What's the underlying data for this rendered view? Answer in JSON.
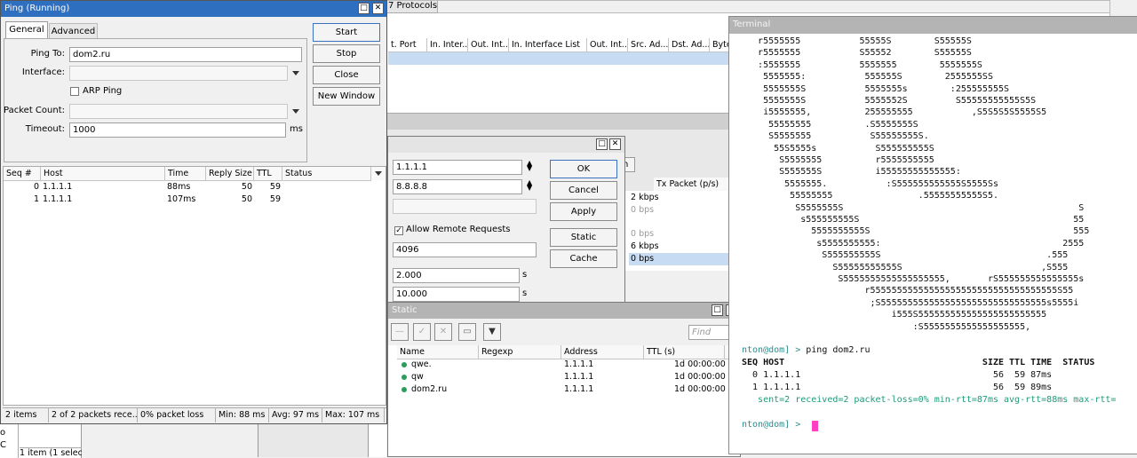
{
  "ping": {
    "title": "Ping (Running)",
    "tabs": [
      "General",
      "Advanced"
    ],
    "labels": {
      "ping_to": "Ping To:",
      "interface": "Interface:",
      "arp_ping": "ARP Ping",
      "packet_count": "Packet Count:",
      "timeout": "Timeout:",
      "timeout_unit": "ms"
    },
    "values": {
      "ping_to": "dom2.ru",
      "timeout": "1000"
    },
    "buttons": {
      "start": "Start",
      "stop": "Stop",
      "close": "Close",
      "new_window": "New Window"
    },
    "columns": [
      "Seq #",
      "Host",
      "Time",
      "Reply Size",
      "TTL",
      "Status"
    ],
    "rows": [
      {
        "seq": "0",
        "host": "1.1.1.1",
        "time": "88ms",
        "size": "50",
        "ttl": "59"
      },
      {
        "seq": "1",
        "host": "1.1.1.1",
        "time": "107ms",
        "size": "50",
        "ttl": "59"
      }
    ],
    "status_bar": [
      "2 items",
      "2 of 2 packets rece...",
      "0% packet loss",
      "Min: 88 ms",
      "Avg: 97 ms",
      "Max: 107 ms"
    ]
  },
  "protocols": {
    "tab": "7 Protocols",
    "columns": [
      "t. Port",
      "In. Inter...",
      "Out. Int...",
      "In. Interface List",
      "Out. Int...",
      "Src. Ad...",
      "Dst. Ad...",
      "Byte"
    ]
  },
  "traffic": {
    "tab_fragment": "n",
    "column": "Tx Packet (p/s)",
    "rows": [
      "2 kbps",
      "0 bps",
      "0 bps",
      "6 kbps",
      "0 bps"
    ]
  },
  "dns": {
    "servers": [
      "1.1.1.1",
      "8.8.8.8"
    ],
    "allow_remote": "Allow Remote Requests",
    "max_udp": "4096",
    "timeouts": [
      "2.000",
      "10.000"
    ],
    "unit": "s",
    "buttons": {
      "ok": "OK",
      "cancel": "Cancel",
      "apply": "Apply",
      "static": "Static",
      "cache": "Cache"
    }
  },
  "dns_static": {
    "title": "Static",
    "find_placeholder": "Find",
    "columns": [
      "Name",
      "Regexp",
      "Address",
      "TTL (s)"
    ],
    "rows": [
      {
        "name": "qwe.",
        "address": "1.1.1.1",
        "ttl": "1d 00:00:00"
      },
      {
        "name": "qw",
        "address": "1.1.1.1",
        "ttl": "1d 00:00:00"
      },
      {
        "name": "dom2.ru",
        "address": "1.1.1.1",
        "ttl": "1d 00:00:00"
      }
    ]
  },
  "bottom_left": {
    "fragments": [
      "o",
      "C"
    ],
    "status": "1 item (1 select"
  },
  "terminal": {
    "title": "Terminal",
    "art": [
      "   r5555555           55555S        S55555S",
      "   r5555555           S55552        S55555S",
      "   :5555555           5555555        5555555S",
      "    5555555:           555555S        2555555SS",
      "    5555555S           5555555s        :255555555S",
      "    5555555S           5555552S         S55555555555S5S",
      "    i5555555,          255555555           ,S5S5S5S5555S5",
      "     55555555          .S5555555S",
      "     S5555555           S55555555S.",
      "      55S5555s           S555555555S",
      "       S5555555          r5555555555",
      "       S555555S          i55555555555555:",
      "        5555555.           :S555555555555S5555Ss",
      "         55555555                .55555555555S5.",
      "          S5555555S                                            S",
      "           s555555555S                                        55",
      "             5555555555S                                      555",
      "              s5555555555:                                  2555",
      "               S555555555S                               .555",
      "                 S55555555555S                          ,S555",
      "                  S5555555555555555555,       rS555555555555555s",
      "                       r55555555555555555555555555555555555S55",
      "                        ;S5555555555555555555555555555555s5555i",
      "                            i555S555555555555555555555555",
      "                                :S5555555555555555555,"
    ],
    "prompt_user": "nton@dom] >",
    "command": "ping dom2.ru",
    "header": "SEQ HOST                                     SIZE TTL TIME  STATUS",
    "rows": [
      "  0 1.1.1.1                                    56  59 87ms",
      "  1 1.1.1.1                                    56  59 89ms"
    ],
    "summary": "   sent=2 received=2 packet-loss=0% min-rtt=87ms avg-rtt=88ms max-rtt=",
    "prompt2": "nton@dom] >",
    "colors": {
      "cursor": "#ff40c0",
      "green": "#1f9a78"
    }
  }
}
